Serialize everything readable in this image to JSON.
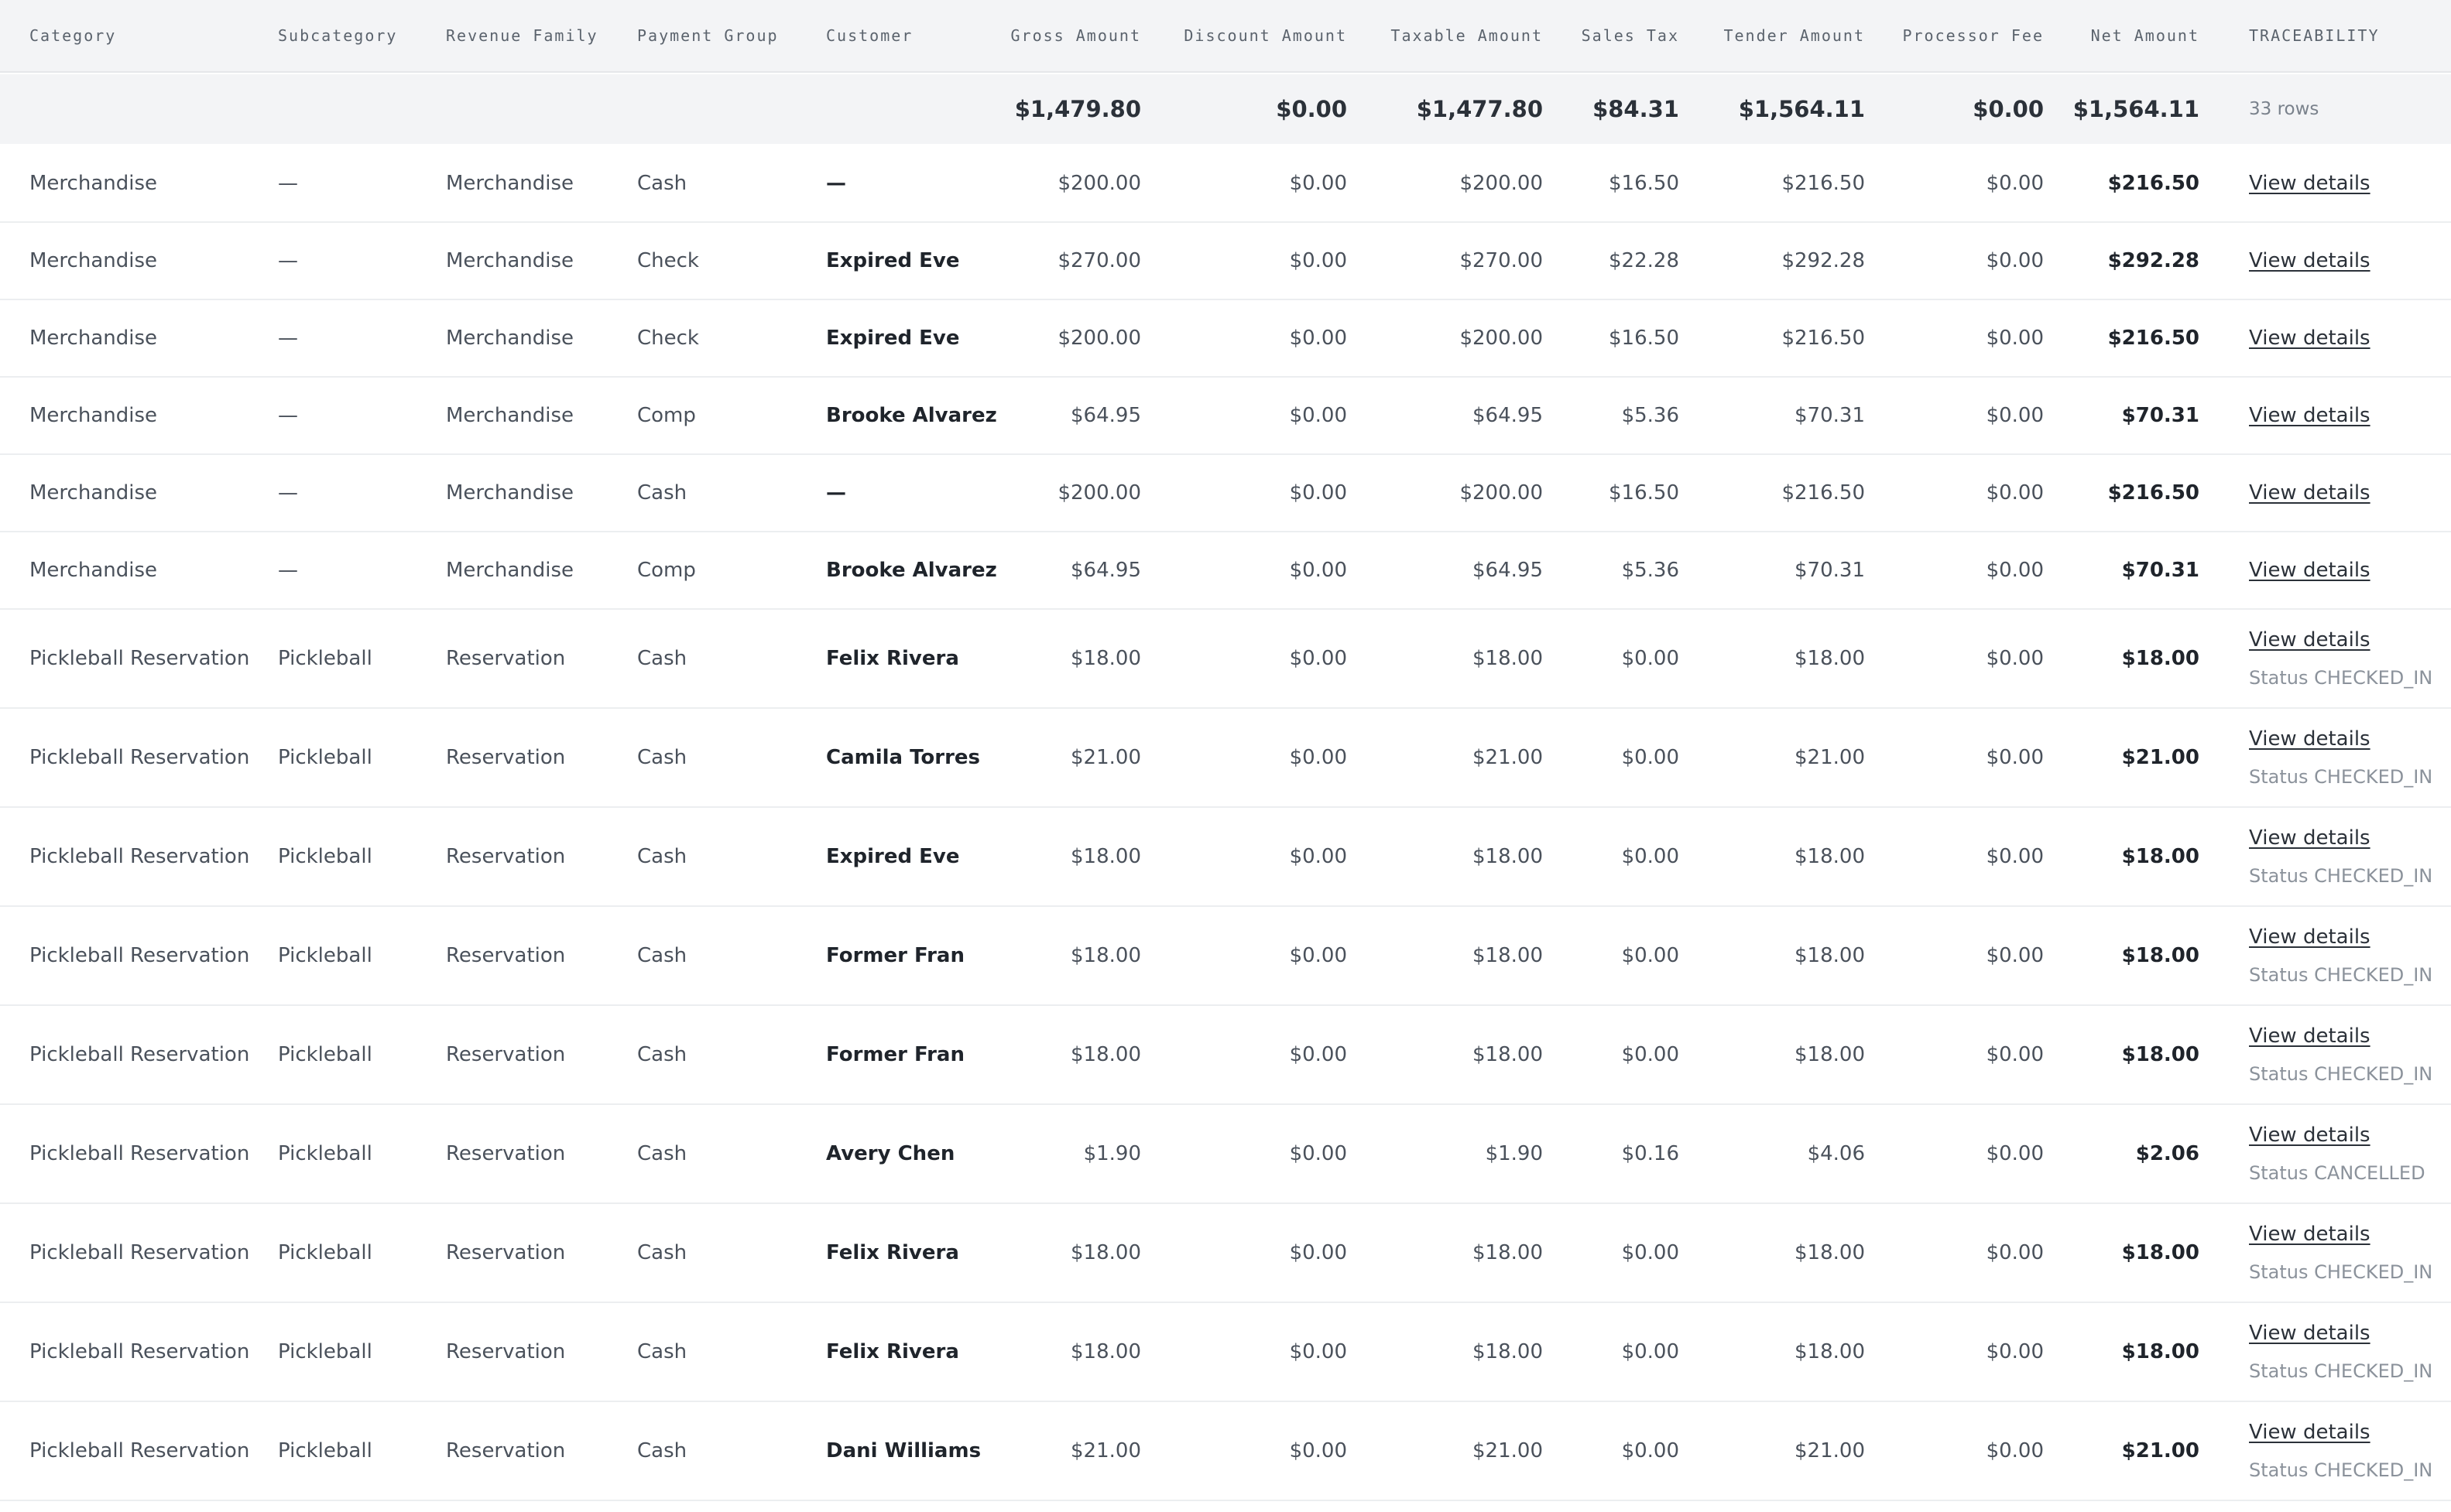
{
  "headers": {
    "category": "Category",
    "subcategory": "Subcategory",
    "revenue_family": "Revenue Family",
    "payment_group": "Payment Group",
    "customer": "Customer",
    "gross": "Gross Amount",
    "discount": "Discount Amount",
    "taxable": "Taxable Amount",
    "sales_tax": "Sales Tax",
    "tender": "Tender Amount",
    "processor_fee": "Processor Fee",
    "net": "Net Amount",
    "traceability": "TRACEABILITY"
  },
  "totals": {
    "gross": "$1,479.80",
    "discount": "$0.00",
    "taxable": "$1,477.80",
    "sales_tax": "$84.31",
    "tender": "$1,564.11",
    "processor_fee": "$0.00",
    "net": "$1,564.11",
    "row_count": "33 rows"
  },
  "link_label": "View details",
  "rows": [
    {
      "category": "Merchandise",
      "subcategory": "—",
      "revenue_family": "Merchandise",
      "payment_group": "Cash",
      "customer": "—",
      "gross": "$200.00",
      "discount": "$0.00",
      "taxable": "$200.00",
      "sales_tax": "$16.50",
      "tender": "$216.50",
      "processor_fee": "$0.00",
      "net": "$216.50",
      "status": ""
    },
    {
      "category": "Merchandise",
      "subcategory": "—",
      "revenue_family": "Merchandise",
      "payment_group": "Check",
      "customer": "Expired Eve",
      "gross": "$270.00",
      "discount": "$0.00",
      "taxable": "$270.00",
      "sales_tax": "$22.28",
      "tender": "$292.28",
      "processor_fee": "$0.00",
      "net": "$292.28",
      "status": ""
    },
    {
      "category": "Merchandise",
      "subcategory": "—",
      "revenue_family": "Merchandise",
      "payment_group": "Check",
      "customer": "Expired Eve",
      "gross": "$200.00",
      "discount": "$0.00",
      "taxable": "$200.00",
      "sales_tax": "$16.50",
      "tender": "$216.50",
      "processor_fee": "$0.00",
      "net": "$216.50",
      "status": ""
    },
    {
      "category": "Merchandise",
      "subcategory": "—",
      "revenue_family": "Merchandise",
      "payment_group": "Comp",
      "customer": "Brooke Alvarez",
      "gross": "$64.95",
      "discount": "$0.00",
      "taxable": "$64.95",
      "sales_tax": "$5.36",
      "tender": "$70.31",
      "processor_fee": "$0.00",
      "net": "$70.31",
      "status": ""
    },
    {
      "category": "Merchandise",
      "subcategory": "—",
      "revenue_family": "Merchandise",
      "payment_group": "Cash",
      "customer": "—",
      "gross": "$200.00",
      "discount": "$0.00",
      "taxable": "$200.00",
      "sales_tax": "$16.50",
      "tender": "$216.50",
      "processor_fee": "$0.00",
      "net": "$216.50",
      "status": ""
    },
    {
      "category": "Merchandise",
      "subcategory": "—",
      "revenue_family": "Merchandise",
      "payment_group": "Comp",
      "customer": "Brooke Alvarez",
      "gross": "$64.95",
      "discount": "$0.00",
      "taxable": "$64.95",
      "sales_tax": "$5.36",
      "tender": "$70.31",
      "processor_fee": "$0.00",
      "net": "$70.31",
      "status": ""
    },
    {
      "category": "Pickleball Reservation",
      "subcategory": "Pickleball",
      "revenue_family": "Reservation",
      "payment_group": "Cash",
      "customer": "Felix Rivera",
      "gross": "$18.00",
      "discount": "$0.00",
      "taxable": "$18.00",
      "sales_tax": "$0.00",
      "tender": "$18.00",
      "processor_fee": "$0.00",
      "net": "$18.00",
      "status": "Status CHECKED_IN"
    },
    {
      "category": "Pickleball Reservation",
      "subcategory": "Pickleball",
      "revenue_family": "Reservation",
      "payment_group": "Cash",
      "customer": "Camila Torres",
      "gross": "$21.00",
      "discount": "$0.00",
      "taxable": "$21.00",
      "sales_tax": "$0.00",
      "tender": "$21.00",
      "processor_fee": "$0.00",
      "net": "$21.00",
      "status": "Status CHECKED_IN"
    },
    {
      "category": "Pickleball Reservation",
      "subcategory": "Pickleball",
      "revenue_family": "Reservation",
      "payment_group": "Cash",
      "customer": "Expired Eve",
      "gross": "$18.00",
      "discount": "$0.00",
      "taxable": "$18.00",
      "sales_tax": "$0.00",
      "tender": "$18.00",
      "processor_fee": "$0.00",
      "net": "$18.00",
      "status": "Status CHECKED_IN"
    },
    {
      "category": "Pickleball Reservation",
      "subcategory": "Pickleball",
      "revenue_family": "Reservation",
      "payment_group": "Cash",
      "customer": "Former Fran",
      "gross": "$18.00",
      "discount": "$0.00",
      "taxable": "$18.00",
      "sales_tax": "$0.00",
      "tender": "$18.00",
      "processor_fee": "$0.00",
      "net": "$18.00",
      "status": "Status CHECKED_IN"
    },
    {
      "category": "Pickleball Reservation",
      "subcategory": "Pickleball",
      "revenue_family": "Reservation",
      "payment_group": "Cash",
      "customer": "Former Fran",
      "gross": "$18.00",
      "discount": "$0.00",
      "taxable": "$18.00",
      "sales_tax": "$0.00",
      "tender": "$18.00",
      "processor_fee": "$0.00",
      "net": "$18.00",
      "status": "Status CHECKED_IN"
    },
    {
      "category": "Pickleball Reservation",
      "subcategory": "Pickleball",
      "revenue_family": "Reservation",
      "payment_group": "Cash",
      "customer": "Avery Chen",
      "gross": "$1.90",
      "discount": "$0.00",
      "taxable": "$1.90",
      "sales_tax": "$0.16",
      "tender": "$4.06",
      "processor_fee": "$0.00",
      "net": "$2.06",
      "status": "Status CANCELLED"
    },
    {
      "category": "Pickleball Reservation",
      "subcategory": "Pickleball",
      "revenue_family": "Reservation",
      "payment_group": "Cash",
      "customer": "Felix Rivera",
      "gross": "$18.00",
      "discount": "$0.00",
      "taxable": "$18.00",
      "sales_tax": "$0.00",
      "tender": "$18.00",
      "processor_fee": "$0.00",
      "net": "$18.00",
      "status": "Status CHECKED_IN"
    },
    {
      "category": "Pickleball Reservation",
      "subcategory": "Pickleball",
      "revenue_family": "Reservation",
      "payment_group": "Cash",
      "customer": "Felix Rivera",
      "gross": "$18.00",
      "discount": "$0.00",
      "taxable": "$18.00",
      "sales_tax": "$0.00",
      "tender": "$18.00",
      "processor_fee": "$0.00",
      "net": "$18.00",
      "status": "Status CHECKED_IN"
    },
    {
      "category": "Pickleball Reservation",
      "subcategory": "Pickleball",
      "revenue_family": "Reservation",
      "payment_group": "Cash",
      "customer": "Dani Williams",
      "gross": "$21.00",
      "discount": "$0.00",
      "taxable": "$21.00",
      "sales_tax": "$0.00",
      "tender": "$21.00",
      "processor_fee": "$0.00",
      "net": "$21.00",
      "status": "Status CHECKED_IN"
    }
  ]
}
